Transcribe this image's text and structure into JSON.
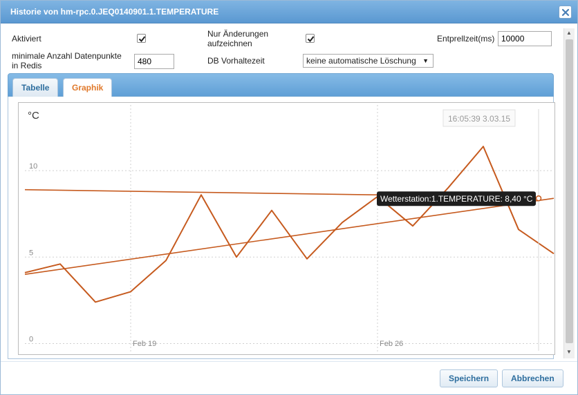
{
  "dialog": {
    "title": "Historie von hm-rpc.0.JEQ0140901.1.TEMPERATURE",
    "close_icon": "close-icon"
  },
  "settings": {
    "enabled_label": "Aktiviert",
    "enabled_checked": true,
    "changes_only_label_line1": "Nur Änderungen",
    "changes_only_label_line2": "aufzeichnen",
    "changes_only_checked": true,
    "debounce_label": "Entprellzeit(ms)",
    "debounce_value": "10000",
    "min_points_label_line1": "minimale Anzahl Datenpunkte",
    "min_points_label_line2": "in Redis",
    "min_points_value": "480",
    "retention_label": "DB Vorhaltezeit",
    "retention_value": "keine automatische Löschung"
  },
  "tabs": [
    {
      "label": "Tabelle",
      "active": false
    },
    {
      "label": "Graphik",
      "active": true
    }
  ],
  "footer": {
    "save_label": "Speichern",
    "cancel_label": "Abbrechen"
  },
  "chart_data": {
    "type": "line",
    "ylabel": "°C",
    "ylim": [
      -0.5,
      13.8
    ],
    "yticks": [
      0,
      5,
      10
    ],
    "xlim": [
      "2015-02-16",
      "2015-03-03"
    ],
    "xticks": [
      {
        "label": "Feb 19",
        "date": "2015-02-19"
      },
      {
        "label": "Feb 26",
        "date": "2015-02-26"
      }
    ],
    "grid": true,
    "hover_time_label": "16:05:39 3.03.15",
    "tooltip": "Wetterstation:1.TEMPERATURE: 8,40 °C",
    "series": [
      {
        "color": "#c65a1e",
        "points": [
          [
            "2015-02-16",
            4.1
          ],
          [
            "2015-02-17",
            4.6
          ],
          [
            "2015-02-18",
            2.4
          ],
          [
            "2015-02-19",
            3.0
          ],
          [
            "2015-02-20",
            4.8
          ],
          [
            "2015-02-21",
            8.6
          ],
          [
            "2015-02-22",
            5.0
          ],
          [
            "2015-02-23",
            7.7
          ],
          [
            "2015-02-24",
            4.9
          ],
          [
            "2015-02-25",
            7.0
          ],
          [
            "2015-02-26",
            8.5
          ],
          [
            "2015-02-27",
            6.8
          ],
          [
            "2015-02-28",
            9.0
          ],
          [
            "2015-03-01",
            11.4
          ],
          [
            "2015-03-02",
            6.6
          ],
          [
            "2015-03-03",
            5.2
          ]
        ]
      },
      {
        "color": "#c65a1e",
        "points": [
          [
            "2015-02-16",
            4.0
          ],
          [
            "2015-03-03",
            8.4
          ]
        ]
      },
      {
        "color": "#c65a1e",
        "points": [
          [
            "2015-02-16",
            8.9
          ],
          [
            "2015-02-26",
            8.6
          ]
        ]
      }
    ]
  }
}
